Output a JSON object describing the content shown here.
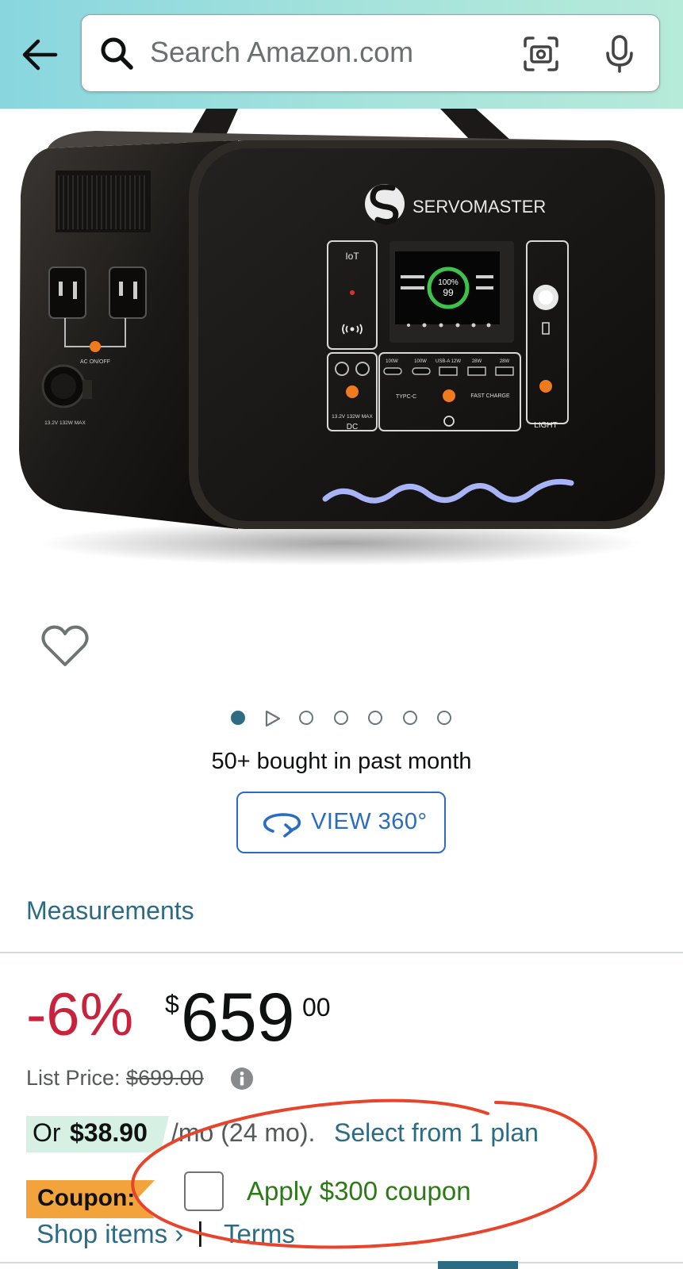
{
  "header": {
    "back_icon": "arrow-left-icon",
    "search": {
      "placeholder": "Search Amazon.com",
      "value": "",
      "icon": "search-icon",
      "camera_icon": "camera-scan-icon",
      "mic_icon": "microphone-icon"
    },
    "gradient_colors": [
      "#89d6df",
      "#b6ead9"
    ]
  },
  "product_image": {
    "brand_text": "SERVOMASTER",
    "panel_labels": {
      "iot": "IoT",
      "ac": "AC ON/OFF",
      "car_port": "13.2V 132W MAX",
      "dc_spec": "13.2V 132W MAX",
      "dc": "DC",
      "port_100w_a": "100W",
      "port_100w_b": "100W",
      "port_usba": "USB-A 12W",
      "port_28w_a": "28W",
      "port_28w_b": "28W",
      "typec": "TYPC-C",
      "fast_charge": "FAST CHARGE",
      "light": "LIGHT",
      "screen_pct": "100%",
      "screen_val": "99"
    }
  },
  "wishlist": {
    "icon": "heart-icon"
  },
  "carousel": {
    "count": 7,
    "active_index": 0,
    "video_index": 1
  },
  "social_proof": "50+ bought in past month",
  "view360": {
    "label": "VIEW 360°",
    "icon": "rotate-360-icon"
  },
  "measurements_link": "Measurements",
  "price": {
    "discount": "-6%",
    "currency_symbol": "$",
    "whole": "659",
    "fraction": "00",
    "list_price_label": "List Price:",
    "list_price_value": "$699.00",
    "info_icon": "info-icon"
  },
  "financing": {
    "prefix": "Or",
    "amount": "$38.90",
    "term": "/mo (24 mo).",
    "link": "Select from 1 plan"
  },
  "coupon": {
    "badge": "Coupon:",
    "apply_text": "Apply $300 coupon",
    "checked": false
  },
  "links": {
    "shop_items": "Shop items ›",
    "separator": "|",
    "terms": "Terms"
  },
  "colors": {
    "discount": "#c7233c",
    "link": "#2d6b83",
    "coupon_badge": "#f3a33b",
    "coupon_text": "#2c7a16",
    "financing_badge": "#d6f1e4",
    "annotation": "#e8432b"
  }
}
